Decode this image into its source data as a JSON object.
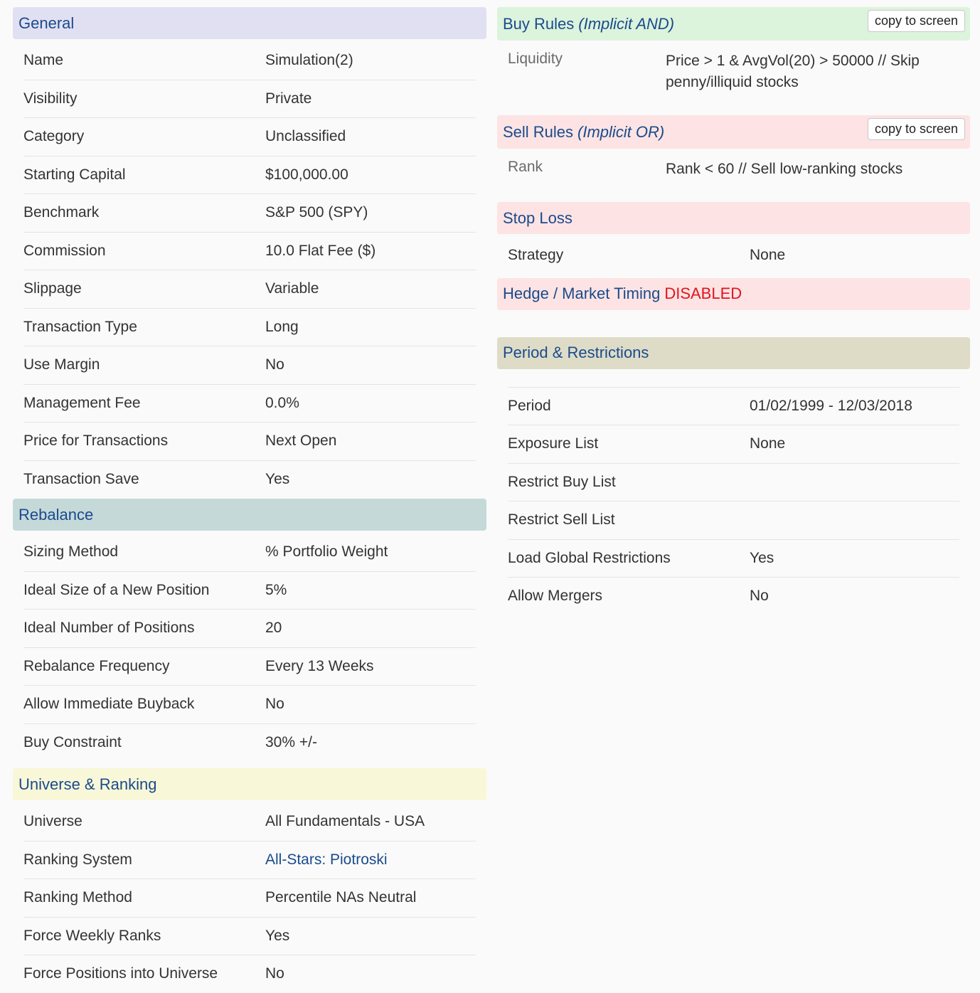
{
  "general": {
    "title": "General",
    "rows": [
      {
        "label": "Name",
        "value": "Simulation(2)"
      },
      {
        "label": "Visibility",
        "value": "Private"
      },
      {
        "label": "Category",
        "value": "Unclassified"
      },
      {
        "label": "Starting Capital",
        "value": "$100,000.00"
      },
      {
        "label": "Benchmark",
        "value": "S&P 500 (SPY)"
      },
      {
        "label": "Commission",
        "value": "10.0 Flat Fee ($)"
      },
      {
        "label": "Slippage",
        "value": "Variable"
      },
      {
        "label": "Transaction Type",
        "value": "Long"
      },
      {
        "label": "Use Margin",
        "value": "No"
      },
      {
        "label": "Management Fee",
        "value": "0.0%"
      },
      {
        "label": "Price for Transactions",
        "value": "Next Open"
      },
      {
        "label": "Transaction Save",
        "value": "Yes"
      }
    ]
  },
  "rebalance": {
    "title": "Rebalance",
    "rows": [
      {
        "label": "Sizing Method",
        "value": "% Portfolio Weight"
      },
      {
        "label": "Ideal Size of a New Position",
        "value": "5%"
      },
      {
        "label": "Ideal Number of Positions",
        "value": "20"
      },
      {
        "label": "Rebalance Frequency",
        "value": "Every 13 Weeks"
      },
      {
        "label": "Allow Immediate Buyback",
        "value": "No"
      },
      {
        "label": "Buy Constraint",
        "value": "30% +/-"
      }
    ]
  },
  "universe": {
    "title": "Universe & Ranking",
    "rows": [
      {
        "label": "Universe",
        "value": "All Fundamentals - USA"
      },
      {
        "label": "Ranking System",
        "value": "All-Stars: Piotroski"
      },
      {
        "label": "Ranking Method",
        "value": "Percentile NAs Neutral"
      },
      {
        "label": "Force Weekly Ranks",
        "value": "Yes"
      },
      {
        "label": "Force Positions into Universe",
        "value": "No"
      }
    ]
  },
  "buy_rules": {
    "title": "Buy Rules",
    "qualifier": "(Implicit AND)",
    "copy_label": "copy to screen",
    "rule_label": "Liquidity",
    "rule_value": "Price > 1 & AvgVol(20) > 50000 // Skip penny/illiquid stocks"
  },
  "sell_rules": {
    "title": "Sell Rules",
    "qualifier": "(Implicit OR)",
    "copy_label": "copy to screen",
    "rule_label": "Rank",
    "rule_value": "Rank < 60 // Sell low-ranking stocks"
  },
  "stop_loss": {
    "title": "Stop Loss",
    "rows": [
      {
        "label": "Strategy",
        "value": "None"
      }
    ]
  },
  "hedge": {
    "title": "Hedge / Market Timing",
    "status": "DISABLED"
  },
  "period": {
    "title": "Period & Restrictions",
    "rows": [
      {
        "label": "Period",
        "value": "01/02/1999 - 12/03/2018"
      },
      {
        "label": "Exposure List",
        "value": "None"
      },
      {
        "label": "Restrict Buy List",
        "value": ""
      },
      {
        "label": "Restrict Sell List",
        "value": ""
      },
      {
        "label": "Load Global Restrictions",
        "value": "Yes"
      },
      {
        "label": "Allow Mergers",
        "value": "No"
      }
    ]
  },
  "colors": {
    "header_text": "#1a4b8c",
    "disabled": "#e0141e",
    "general_bg": "#e1e0f2",
    "rebalance_bg": "#c5d9d9",
    "universe_bg": "#f8f7d8",
    "buy_bg": "#dcf3dc",
    "sell_bg": "#fde3e3",
    "period_bg": "#dedcc7"
  }
}
